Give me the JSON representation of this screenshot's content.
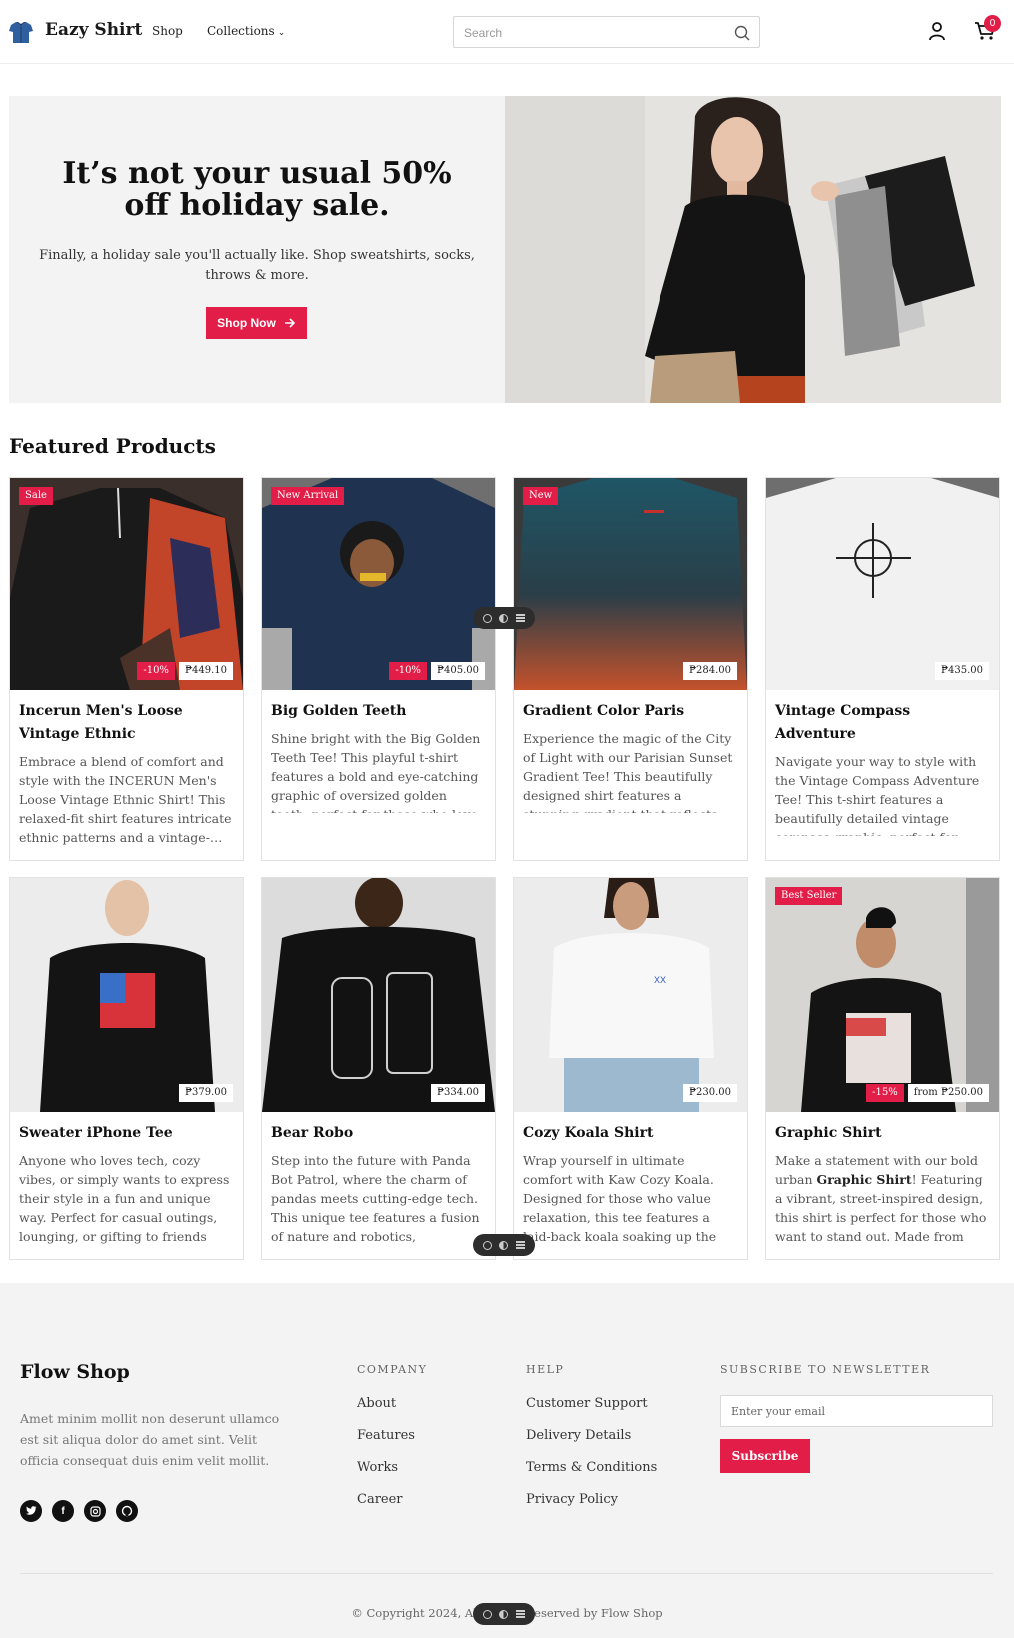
{
  "header": {
    "brand": "Eazy Shirt",
    "nav": {
      "shop": "Shop",
      "collections": "Collections"
    },
    "search_placeholder": "Search",
    "cart_count": "0"
  },
  "hero": {
    "title": "It’s not your usual 50% off holiday sale.",
    "subtitle": "Finally, a holiday sale you'll actually like. Shop sweatshirts, socks, throws & more.",
    "button_label": "Shop Now"
  },
  "featured": {
    "title": "Featured Products",
    "products": [
      {
        "tag": "Sale",
        "discount": "-10%",
        "price": "₱449.10",
        "name": "Incerun Men's Loose Vintage Ethnic",
        "description": "Embrace a blend of comfort and style with the INCERUN Men's Loose Vintage Ethnic Shirt! This relaxed-fit shirt features intricate ethnic patterns and a vintage-…"
      },
      {
        "tag": "New Arrival",
        "discount": "-10%",
        "price": "₱405.00",
        "name": "Big Golden Teeth",
        "description": "Shine bright with the Big Golden Teeth Tee! This playful t-shirt features a bold and eye-catching graphic of oversized golden teeth, perfect for those who love to stan…"
      },
      {
        "tag": "New",
        "discount": "",
        "price": "₱284.00",
        "name": "Gradient Color Paris",
        "description": "Experience the magic of the City of Light with our Parisian Sunset Gradient Tee! This beautifully designed shirt features a stunning gradient that reflects the vibrant…"
      },
      {
        "tag": "",
        "discount": "",
        "price": "₱435.00",
        "name": "Vintage Compass Adventure",
        "description": "Navigate your way to style with the Vintage Compass Adventure Tee! This t-shirt features a beautifully detailed vintage compass graphic, perfect for wanderers and…"
      },
      {
        "tag": "",
        "discount": "",
        "price": "₱379.00",
        "name": "Sweater iPhone Tee",
        "description": "Anyone who loves tech, cozy vibes, or simply wants to express their style in a fun and unique way. Perfect for casual outings, lounging, or gifting to friends who appreciat…"
      },
      {
        "tag": "",
        "discount": "",
        "price": "₱334.00",
        "name": "Bear Robo",
        "description": "Step into the future with Panda Bot Patrol, where the charm of pandas meets cutting-edge tech. This unique tee features a fusion of nature and robotics, showcasing a…"
      },
      {
        "tag": "",
        "discount": "",
        "price": "₱230.00",
        "name": "Cozy Koala Shirt",
        "description": "Wrap yourself in ultimate comfort with Kaw Cozy Koala. Designed for those who value relaxation, this tee features a laid-back koala soaking up the vibes. Perfect for chill days,…"
      },
      {
        "tag": "Best Seller",
        "discount": "-15%",
        "price": "from ₱250.00",
        "name": "Graphic Shirt",
        "description_pre": "Make a statement with our bold urban ",
        "description_bold": "Graphic Shirt",
        "description_post": "! Featuring a vibrant, street-inspired design, this shirt is perfect for those who want to stand out. Made from soft,…"
      }
    ]
  },
  "footer": {
    "brand": "Flow Shop",
    "about": "Amet minim mollit non deserunt ullamco est sit aliqua dolor do amet sint. Velit officia consequat duis enim velit mollit.",
    "socials": [
      "twitter-icon",
      "facebook-icon",
      "instagram-icon",
      "github-icon"
    ],
    "company": {
      "heading": "COMPANY",
      "links": [
        "About",
        "Features",
        "Works",
        "Career"
      ]
    },
    "help": {
      "heading": "HELP",
      "links": [
        "Customer Support",
        "Delivery Details",
        "Terms & Conditions",
        "Privacy Policy"
      ]
    },
    "newsletter": {
      "heading": "SUBSCRIBE TO NEWSLETTER",
      "placeholder": "Enter your email",
      "button_label": "Subscribe"
    },
    "copyright": "© Copyright 2024, All Rights Reserved by Flow Shop"
  },
  "colors": {
    "accent": "#e11d48",
    "footer_bg": "#f3f3f3",
    "hero_bg": "#f3f3f3"
  }
}
